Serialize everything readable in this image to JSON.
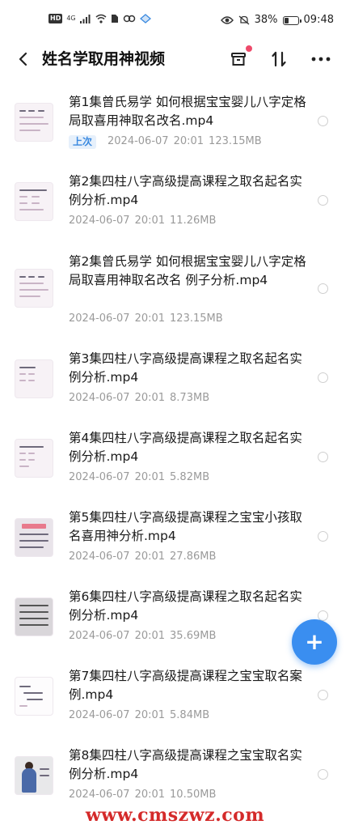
{
  "status_bar": {
    "hd": "HD",
    "network": "4G",
    "battery_text": "38%",
    "battery_level": 0.38,
    "time": "09:48"
  },
  "header": {
    "title": "姓名学取用神视频"
  },
  "files": [
    {
      "name": "第1集曾氏易学 如何根据宝宝婴儿八字定格局取喜用神取名改名.mp4",
      "badge": "上次",
      "date": "2024-06-07",
      "time": "20:01",
      "size": "123.15MB"
    },
    {
      "name": "第2集四柱八字高级提高课程之取名起名实例分析.mp4",
      "badge": "",
      "date": "2024-06-07",
      "time": "20:01",
      "size": "11.26MB"
    },
    {
      "name": "第2集曾氏易学 如何根据宝宝婴儿八字定格局取喜用神取名改名 例子分析.mp4",
      "badge": "",
      "date": "2024-06-07",
      "time": "20:01",
      "size": "123.15MB"
    },
    {
      "name": "第3集四柱八字高级提高课程之取名起名实例分析.mp4",
      "badge": "",
      "date": "2024-06-07",
      "time": "20:01",
      "size": "8.73MB"
    },
    {
      "name": "第4集四柱八字高级提高课程之取名起名实例分析.mp4",
      "badge": "",
      "date": "2024-06-07",
      "time": "20:01",
      "size": "5.82MB"
    },
    {
      "name": "第5集四柱八字高级提高课程之宝宝小孩取名喜用神分析.mp4",
      "badge": "",
      "date": "2024-06-07",
      "time": "20:01",
      "size": "27.86MB"
    },
    {
      "name": "第6集四柱八字高级提高课程之取名起名实例分析.mp4",
      "badge": "",
      "date": "2024-06-07",
      "time": "20:01",
      "size": "35.69MB"
    },
    {
      "name": "第7集四柱八字高级提高课程之宝宝取名案例.mp4",
      "badge": "",
      "date": "2024-06-07",
      "time": "20:01",
      "size": "5.84MB"
    },
    {
      "name": "第8集四柱八字高级提高课程之宝宝取名实例分析.mp4",
      "badge": "",
      "date": "2024-06-07",
      "time": "20:01",
      "size": "10.50MB"
    }
  ],
  "fab": {
    "icon": "plus-icon",
    "symbol": "+"
  },
  "watermark": "www.cmszwz.com",
  "colors": {
    "accent": "#3a8ef0",
    "badge": "#3b8ae0",
    "watermark": "#d42a2a",
    "notify_dot": "#ee4a6a"
  }
}
